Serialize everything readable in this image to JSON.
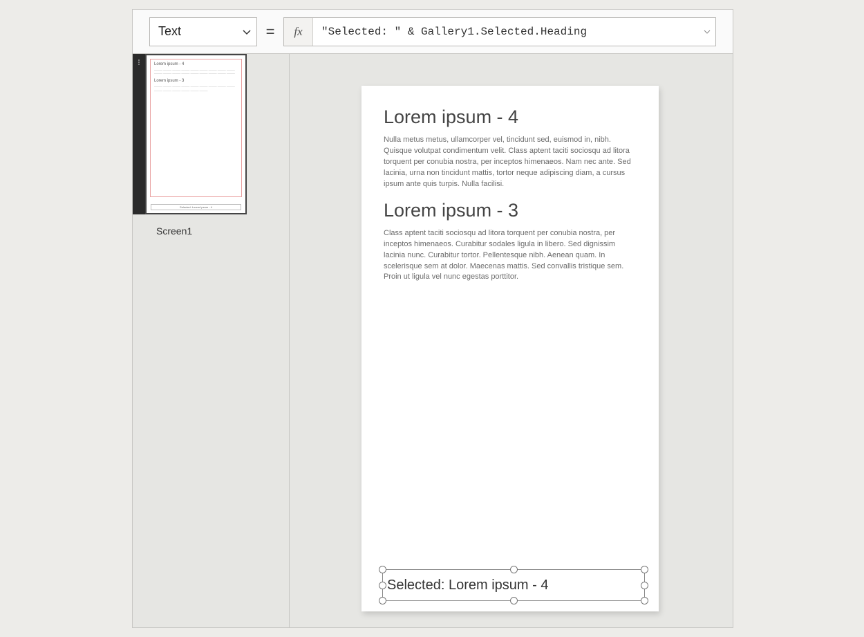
{
  "formulaBar": {
    "propertyLabel": "Text",
    "fxSymbol": "fx",
    "equals": "=",
    "formula": "\"Selected: \" & Gallery1.Selected.Heading"
  },
  "thumbnail": {
    "screenLabel": "Screen1",
    "items": [
      {
        "heading": "Lorem ipsum - 4"
      },
      {
        "heading": "Lorem ipsum - 3"
      }
    ],
    "selectedPreview": "Selected: Lorem Ipsum - 4"
  },
  "canvas": {
    "gallery": [
      {
        "heading": "Lorem ipsum - 4",
        "body": "Nulla metus metus, ullamcorper vel, tincidunt sed, euismod in, nibh. Quisque volutpat condimentum velit. Class aptent taciti sociosqu ad litora torquent per conubia nostra, per inceptos himenaeos. Nam nec ante. Sed lacinia, urna non tincidunt mattis, tortor neque adipiscing diam, a cursus ipsum ante quis turpis. Nulla facilisi."
      },
      {
        "heading": "Lorem ipsum - 3",
        "body": "Class aptent taciti sociosqu ad litora torquent per conubia nostra, per inceptos himenaeos. Curabitur sodales ligula in libero. Sed dignissim lacinia nunc. Curabitur tortor. Pellentesque nibh. Aenean quam. In scelerisque sem at dolor. Maecenas mattis. Sed convallis tristique sem. Proin ut ligula vel nunc egestas porttitor."
      }
    ],
    "selectedLabelText": "Selected: Lorem ipsum - 4"
  }
}
